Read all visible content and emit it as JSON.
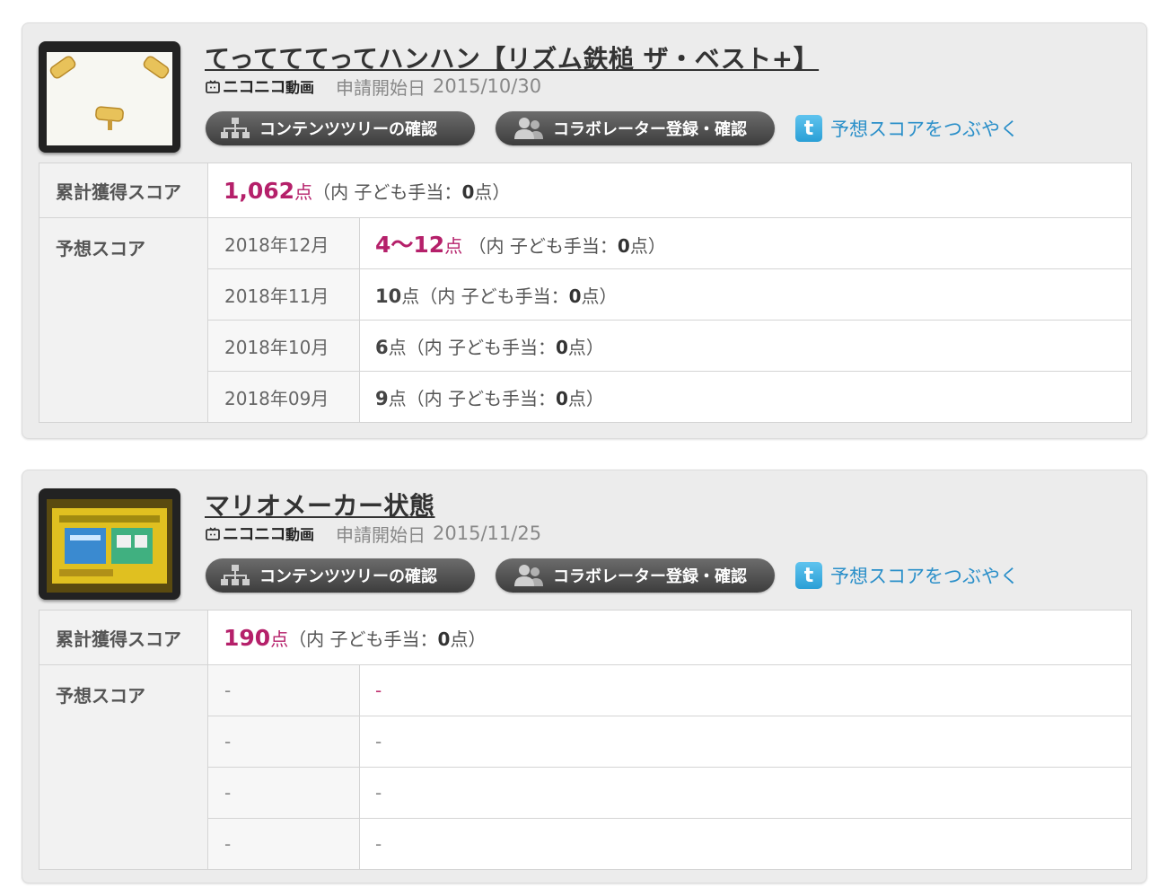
{
  "colors": {
    "score_accent": "#b5206a",
    "tweet_link": "#2a8fc9",
    "button_dark": "#4a4a4a"
  },
  "labels": {
    "total_score": "累計獲得スコア",
    "predicted_score": "予想スコア",
    "content_tree_button": "コンテンツツリーの確認",
    "collaborator_button": "コラボレーター登録・確認",
    "tweet_link": "予想スコアをつぶやく",
    "apply_date": "申請開始日",
    "service_name": "ニコニコ",
    "service_suffix": "動画",
    "point_unit": "点",
    "kodomo_open": "（内 子ども手当：",
    "kodomo_close": "点）"
  },
  "icons": {
    "service": "tv-icon",
    "tree": "tree-icon",
    "collaborator": "people-icon",
    "tweet": "twitter-icon"
  },
  "works": [
    {
      "title": "てってててってハンハン【リズム鉄槌 ザ・ベスト+】",
      "apply_date": "2015/10/30",
      "total": {
        "points": "1,062",
        "kodomo": "0"
      },
      "predictions": [
        {
          "month": "2018年12月",
          "points": "4〜12",
          "kodomo": "0",
          "highlight": true
        },
        {
          "month": "2018年11月",
          "points": "10",
          "kodomo": "0",
          "highlight": false
        },
        {
          "month": "2018年10月",
          "points": "6",
          "kodomo": "0",
          "highlight": false
        },
        {
          "month": "2018年09月",
          "points": "9",
          "kodomo": "0",
          "highlight": false
        }
      ]
    },
    {
      "title": "マリオメーカー状態",
      "apply_date": "2015/11/25",
      "total": {
        "points": "190",
        "kodomo": "0"
      },
      "predictions": [
        {
          "month": "-",
          "value": "-"
        },
        {
          "month": "-",
          "value": "-"
        },
        {
          "month": "-",
          "value": "-"
        },
        {
          "month": "-",
          "value": "-"
        }
      ]
    }
  ]
}
